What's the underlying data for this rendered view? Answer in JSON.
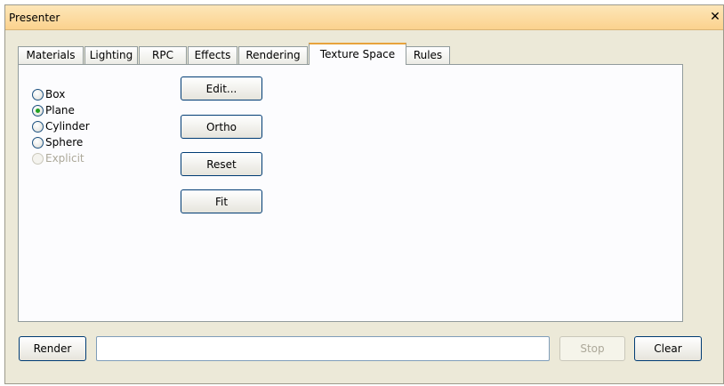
{
  "window": {
    "title": "Presenter"
  },
  "tabs": [
    {
      "label": "Materials",
      "active": false
    },
    {
      "label": "Lighting",
      "active": false
    },
    {
      "label": "RPC",
      "active": false
    },
    {
      "label": "Effects",
      "active": false
    },
    {
      "label": "Rendering",
      "active": false
    },
    {
      "label": "Texture Space",
      "active": true
    },
    {
      "label": "Rules",
      "active": false
    }
  ],
  "mapping_options": [
    {
      "label": "Box",
      "checked": false,
      "enabled": true
    },
    {
      "label": "Plane",
      "checked": true,
      "enabled": true
    },
    {
      "label": "Cylinder",
      "checked": false,
      "enabled": true
    },
    {
      "label": "Sphere",
      "checked": false,
      "enabled": true
    },
    {
      "label": "Explicit",
      "checked": false,
      "enabled": false
    }
  ],
  "actions": {
    "edit": "Edit...",
    "ortho": "Ortho",
    "reset": "Reset",
    "fit": "Fit"
  },
  "footer": {
    "render": "Render",
    "status_value": "",
    "stop": "Stop",
    "stop_enabled": false,
    "clear": "Clear"
  },
  "colors": {
    "titlebar": "#fbd28e",
    "active_tab_highlight": "#e8a33c",
    "radio_checked": "#21a121",
    "button_border": "#003c74"
  },
  "icons": {
    "close": "close-icon"
  }
}
